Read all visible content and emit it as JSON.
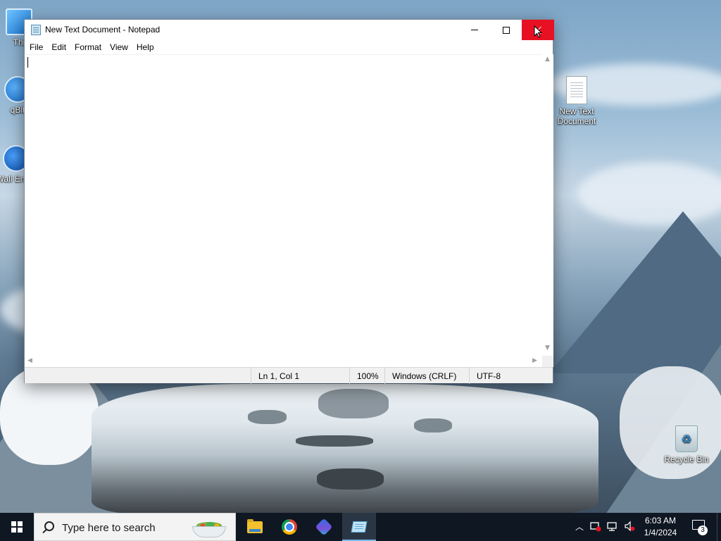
{
  "desktop": {
    "icons": [
      {
        "label": "Thi"
      },
      {
        "label": "qBit"
      },
      {
        "label": "Wall Engin"
      },
      {
        "label": "New Text Document"
      },
      {
        "label": "Recycle Bin"
      }
    ]
  },
  "notepad": {
    "title": "New Text Document - Notepad",
    "menu": [
      "File",
      "Edit",
      "Format",
      "View",
      "Help"
    ],
    "content": "",
    "status": {
      "position": "Ln 1, Col 1",
      "zoom": "100%",
      "line_ending": "Windows (CRLF)",
      "encoding": "UTF-8"
    }
  },
  "taskbar": {
    "search_placeholder": "Type here to search",
    "apps": [
      "file-explorer-icon",
      "chrome-icon",
      "copilot-icon",
      "notepad-icon"
    ],
    "clock_time": "6:03 AM",
    "clock_date": "1/4/2024",
    "notification_count": "3"
  },
  "colors": {
    "close_hover": "#e81123",
    "taskbar": "#0f1722",
    "active_app_indicator": "#76b9ed"
  }
}
